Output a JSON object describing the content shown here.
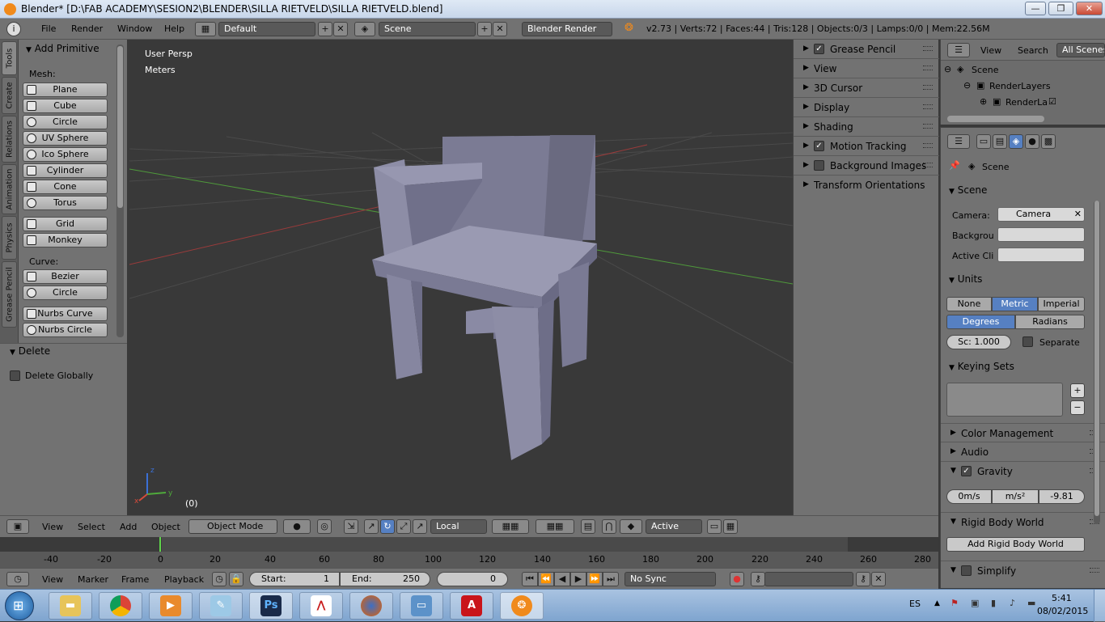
{
  "window": {
    "title": "Blender* [D:\\FAB ACADEMY\\SESION2\\BLENDER\\SILLA RIETVELD\\SILLA RIETVELD.blend]",
    "min": "—",
    "max": "❐",
    "close": "✕"
  },
  "infobar": {
    "menus": [
      "File",
      "Render",
      "Window",
      "Help"
    ],
    "layout": "Default",
    "scene": "Scene",
    "engine": "Blender Render",
    "stats": "v2.73 | Verts:72 | Faces:44 | Tris:128 | Objects:0/3 | Lamps:0/0 | Mem:22.56M",
    "info_icon": "i"
  },
  "lefttabs": [
    "Tools",
    "Create",
    "Relations",
    "Animation",
    "Physics",
    "Grease Pencil"
  ],
  "toolshelf": {
    "panel": "Add Primitive",
    "mesh_label": "Mesh:",
    "mesh": [
      "Plane",
      "Cube",
      "Circle",
      "UV Sphere",
      "Ico Sphere",
      "Cylinder",
      "Cone",
      "Torus"
    ],
    "mesh2": [
      "Grid",
      "Monkey"
    ],
    "curve_label": "Curve:",
    "curve": [
      "Bezier",
      "Circle"
    ],
    "nurbs": [
      "Nurbs Curve",
      "Nurbs Circle"
    ]
  },
  "operator": {
    "panel": "Delete",
    "option": "Delete Globally"
  },
  "viewport": {
    "view": "User Persp",
    "units": "Meters",
    "frame": "(0)",
    "axis_x": "x",
    "axis_y": "y",
    "axis_z": "z"
  },
  "npanel": [
    {
      "label": "Grease Pencil",
      "check": true,
      "checked": true
    },
    {
      "label": "View",
      "check": false
    },
    {
      "label": "3D Cursor",
      "check": false
    },
    {
      "label": "Display",
      "check": false
    },
    {
      "label": "Shading",
      "check": false
    },
    {
      "label": "Motion Tracking",
      "check": true,
      "checked": true
    },
    {
      "label": "Background Images",
      "check": true,
      "checked": false
    },
    {
      "label": "Transform Orientations",
      "check": false
    }
  ],
  "outliner": {
    "view": "View",
    "search": "Search",
    "filter": "All Scenes",
    "tree": [
      "Scene",
      "RenderLayers",
      "RenderLa"
    ]
  },
  "props": {
    "context": "Scene",
    "scene_panel": "Scene",
    "camera_label": "Camera:",
    "camera_value": "Camera",
    "background_label": "Backgrou",
    "activeclip_label": "Active Cli",
    "units_panel": "Units",
    "unit_systems": [
      "None",
      "Metric",
      "Imperial"
    ],
    "rotation": [
      "Degrees",
      "Radians"
    ],
    "scale": "Sc: 1.000",
    "separate": "Separate",
    "keying_panel": "Keying Sets",
    "color_panel": "Color Management",
    "audio_panel": "Audio",
    "gravity_panel": "Gravity",
    "gravity": [
      "0m/s",
      "m/s²",
      "-9.81"
    ],
    "rigid_panel": "Rigid Body World",
    "rigid_btn": "Add Rigid Body World",
    "simplify_panel": "Simplify"
  },
  "vheader": {
    "menus": [
      "View",
      "Select",
      "Add",
      "Object"
    ],
    "mode": "Object Mode",
    "orientation": "Local",
    "snap_target": "Active"
  },
  "timeline": {
    "ticks": [
      "-40",
      "-20",
      "0",
      "20",
      "40",
      "60",
      "80",
      "100",
      "120",
      "140",
      "160",
      "180",
      "200",
      "220",
      "240",
      "260",
      "280"
    ],
    "menus": [
      "View",
      "Marker",
      "Frame",
      "Playback"
    ],
    "start": "Start:",
    "start_val": "1",
    "end": "End:",
    "end_val": "250",
    "current": "0",
    "sync": "No Sync"
  },
  "taskbar": {
    "lang": "ES",
    "time": "5:41",
    "date": "08/02/2015",
    "apps": [
      "Explorer",
      "Chrome",
      "Media",
      "Notepad",
      "Ps",
      "Acrobat",
      "Firefox",
      "Photos",
      "AutoCAD",
      "Blender"
    ]
  },
  "colors": {
    "active_seg": "#5680c2",
    "panel": "#727272",
    "viewport": "#393939"
  }
}
